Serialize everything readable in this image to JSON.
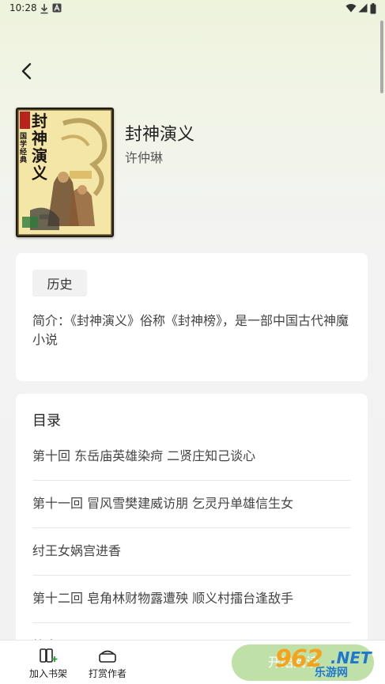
{
  "status_bar": {
    "time": "10:28",
    "icons": [
      "download-icon",
      "a-badge-icon",
      "wifi-icon",
      "signal-icon",
      "battery-icon"
    ]
  },
  "book": {
    "title": "封神演义",
    "author": "许仲琳",
    "cover_title": "封神演义",
    "cover_series": "国学经典"
  },
  "intro_card": {
    "tag_label": "历史",
    "description": "简介：《封神演义》俗称《封神榜》，是一部中国古代神魔小说"
  },
  "toc": {
    "title": "目录",
    "chapters": [
      "第十回 东岳庙英雄染疴 二贤庄知己谈心",
      "第十一回 冒风雪樊建威访朋 乞灵丹单雄信生女",
      "纣王女娲宫进香",
      "第十二回 皂角林财物露遭殃 顺义村擂台逢敌手",
      "第十三回 ..."
    ]
  },
  "bottom_bar": {
    "add_shelf_label": "加入书架",
    "tip_author_label": "打赏作者",
    "read_label": "开始阅读"
  },
  "watermark": {
    "number": "962",
    "domain": ".NET",
    "site_name": "乐游网"
  },
  "colors": {
    "accent_green": "#bfe0a6",
    "card_bg": "#ffffff",
    "page_bg": "#f2f2f2"
  }
}
